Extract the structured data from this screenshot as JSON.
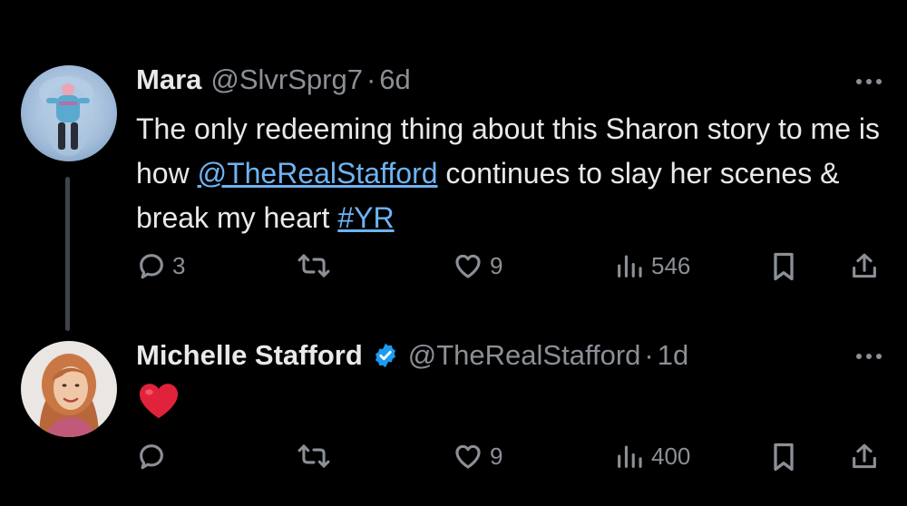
{
  "tweets": [
    {
      "author_name": "Mara",
      "handle": "@SlvrSprg7",
      "separator": "·",
      "time": "6d",
      "text_parts": {
        "p1": "The only redeeming thing about this Sharon story to me is how ",
        "mention": "@TheRealStafford",
        "p2": " continues to slay her scenes & break my heart ",
        "hashtag": "#YR"
      },
      "replies": "3",
      "reposts": "",
      "likes": "9",
      "views": "546"
    },
    {
      "author_name": "Michelle Stafford",
      "verified": true,
      "handle": "@TheRealStafford",
      "separator": "·",
      "time": "1d",
      "text": "❤️",
      "replies": "",
      "reposts": "",
      "likes": "9",
      "views": "400"
    }
  ],
  "colors": {
    "background": "#000000",
    "text": "#e7e9ea",
    "muted": "#8b9096",
    "link": "#6fb3f2",
    "verified": "#1d9bf0",
    "heart": "#e0233b"
  },
  "icons": [
    "reply-icon",
    "repost-icon",
    "like-icon",
    "views-icon",
    "bookmark-icon",
    "share-icon",
    "more-options-icon",
    "verified-badge-icon"
  ]
}
